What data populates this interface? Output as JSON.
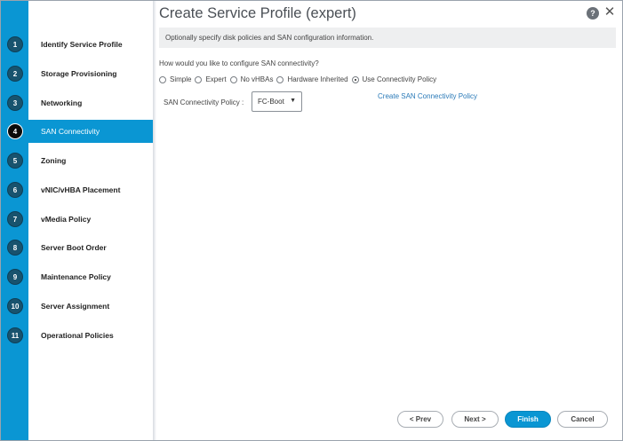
{
  "dialog": {
    "title": "Create Service Profile (expert)",
    "help_label": "?",
    "close_label": "✕",
    "info_text": "Optionally specify disk policies and SAN configuration information."
  },
  "steps": [
    {
      "number": "1",
      "label": "Identify Service Profile"
    },
    {
      "number": "2",
      "label": "Storage Provisioning"
    },
    {
      "number": "3",
      "label": "Networking"
    },
    {
      "number": "4",
      "label": "SAN Connectivity",
      "active": true
    },
    {
      "number": "5",
      "label": "Zoning"
    },
    {
      "number": "6",
      "label": "vNIC/vHBA Placement"
    },
    {
      "number": "7",
      "label": "vMedia Policy"
    },
    {
      "number": "8",
      "label": "Server Boot Order"
    },
    {
      "number": "9",
      "label": "Maintenance Policy"
    },
    {
      "number": "10",
      "label": "Server Assignment"
    },
    {
      "number": "11",
      "label": "Operational Policies"
    }
  ],
  "san": {
    "question": "How would you like to configure SAN connectivity?",
    "options": [
      {
        "label": "Simple",
        "selected": false
      },
      {
        "label": "Expert",
        "selected": false
      },
      {
        "label": "No vHBAs",
        "selected": false
      },
      {
        "label": "Hardware Inherited",
        "selected": false
      },
      {
        "label": "Use Connectivity Policy",
        "selected": true
      }
    ],
    "policy_label": "SAN Connectivity Policy :",
    "policy_value": "FC-Boot",
    "create_link": "Create SAN Connectivity Policy"
  },
  "footer": {
    "prev": "< Prev",
    "next": "Next >",
    "finish": "Finish",
    "cancel": "Cancel"
  },
  "colors": {
    "accent": "#0a96d3",
    "step_badge": "#18536e",
    "link": "#2a7ab8"
  }
}
